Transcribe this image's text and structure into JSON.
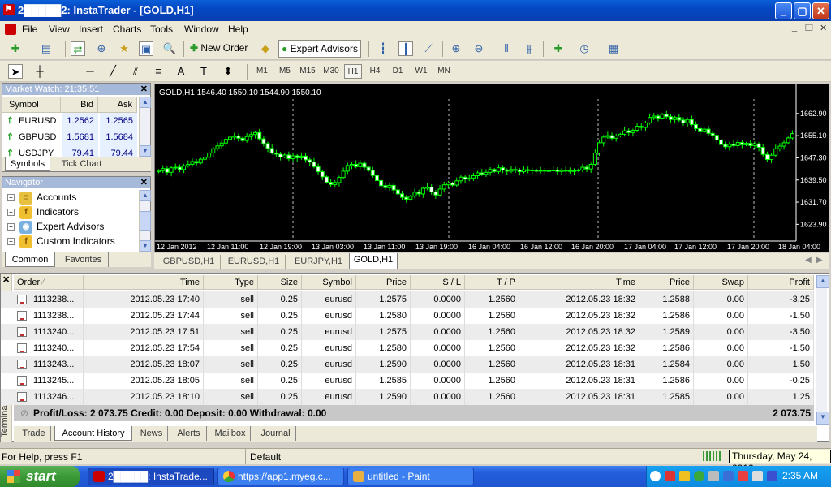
{
  "window": {
    "title": "2█████2: InstaTrader - [GOLD,H1]"
  },
  "menu": [
    "File",
    "View",
    "Insert",
    "Charts",
    "Tools",
    "Window",
    "Help"
  ],
  "toolbar": {
    "new_order": "New Order",
    "expert_advisors": "Expert Advisors"
  },
  "timeframes": [
    "M1",
    "M5",
    "M15",
    "M30",
    "H1",
    "H4",
    "D1",
    "W1",
    "MN"
  ],
  "active_timeframe": "H1",
  "market_watch": {
    "title": "Market Watch: 21:35:51",
    "columns": [
      "Symbol",
      "Bid",
      "Ask"
    ],
    "rows": [
      {
        "symbol": "EURUSD",
        "bid": "1.2562",
        "ask": "1.2565"
      },
      {
        "symbol": "GBPUSD",
        "bid": "1.5681",
        "ask": "1.5684"
      },
      {
        "symbol": "USDJPY",
        "bid": "79.41",
        "ask": "79.44"
      }
    ],
    "tabs": [
      "Symbols",
      "Tick Chart"
    ]
  },
  "navigator": {
    "title": "Navigator",
    "items": [
      "Accounts",
      "Indicators",
      "Expert Advisors",
      "Custom Indicators"
    ],
    "tabs": [
      "Common",
      "Favorites"
    ]
  },
  "chart": {
    "header": "GOLD,H1  1546.40 1550.10 1544.90 1550.10",
    "price_labels": [
      "1662.90",
      "1655.10",
      "1647.30",
      "1639.50",
      "1631.70",
      "1623.90"
    ],
    "time_labels": [
      "12 Jan 2012",
      "12 Jan 11:00",
      "12 Jan 19:00",
      "13 Jan 03:00",
      "13 Jan 11:00",
      "13 Jan 19:00",
      "16 Jan 04:00",
      "16 Jan 12:00",
      "16 Jan 20:00",
      "17 Jan 04:00",
      "17 Jan 12:00",
      "17 Jan 20:00",
      "18 Jan 04:00"
    ],
    "tabs": [
      "GBPUSD,H1",
      "EURUSD,H1",
      "EURJPY,H1",
      "GOLD,H1"
    ],
    "active_tab": "GOLD,H1",
    "colors": {
      "background": "#000000",
      "candle": "#00ff00",
      "text": "#ffffff"
    }
  },
  "chart_data": {
    "type": "candlestick",
    "symbol": "GOLD",
    "timeframe": "H1",
    "ylim": [
      1620.0,
      1668.0
    ],
    "y_ticks": [
      1662.9,
      1655.1,
      1647.3,
      1639.5,
      1631.7,
      1623.9
    ],
    "closes": [
      1642.8,
      1643.5,
      1642.2,
      1643.8,
      1644.0,
      1643.2,
      1644.5,
      1645.0,
      1646.0,
      1645.5,
      1646.8,
      1647.5,
      1649.0,
      1650.5,
      1651.5,
      1652.5,
      1653.8,
      1654.6,
      1655.0,
      1654.2,
      1653.4,
      1654.8,
      1655.5,
      1656.2,
      1654.0,
      1652.3,
      1650.6,
      1649.0,
      1648.6,
      1647.6,
      1648.3,
      1647.0,
      1648.0,
      1647.3,
      1647.9,
      1646.6,
      1645.8,
      1644.2,
      1642.4,
      1640.6,
      1638.7,
      1637.9,
      1638.6,
      1640.4,
      1642.6,
      1644.6,
      1645.0,
      1644.2,
      1645.4,
      1644.0,
      1642.9,
      1641.1,
      1639.3,
      1637.5,
      1636.8,
      1637.6,
      1636.0,
      1634.6,
      1633.4,
      1632.7,
      1633.8,
      1635.2,
      1634.6,
      1636.6,
      1637.0,
      1635.3,
      1634.2,
      1636.3,
      1637.8,
      1638.4,
      1637.7,
      1639.2,
      1640.5,
      1639.8,
      1640.2,
      1641.0,
      1642.0,
      1641.5,
      1642.2,
      1643.2,
      1642.5,
      1643.8,
      1643.0,
      1642.6,
      1643.2,
      1643.0,
      1642.4,
      1643.1,
      1642.8,
      1643.0,
      1642.6,
      1642.9,
      1642.7,
      1642.8,
      1643.0,
      1642.5,
      1642.9,
      1642.8,
      1642.6,
      1642.8,
      1643.0,
      1644.0,
      1643.4,
      1645.0,
      1649.0,
      1652.6,
      1654.6,
      1655.1,
      1654.2,
      1655.0,
      1655.6,
      1656.8,
      1656.2,
      1657.0,
      1658.4,
      1658.0,
      1659.6,
      1661.5,
      1662.0,
      1661.3,
      1662.6,
      1661.8,
      1660.8,
      1661.5,
      1660.6,
      1659.6,
      1660.8,
      1659.0,
      1657.6,
      1656.5,
      1657.4,
      1655.9,
      1655.2,
      1653.6,
      1652.0,
      1651.2,
      1652.1,
      1651.6,
      1652.7,
      1651.9,
      1652.4,
      1651.6,
      1652.2,
      1651.0,
      1648.5,
      1646.7,
      1648.2,
      1650.5,
      1651.4,
      1652.6,
      1654.3,
      1655.8
    ]
  },
  "terminal": {
    "columns": [
      "Order",
      "Time",
      "Type",
      "Size",
      "Symbol",
      "Price",
      "S / L",
      "T / P",
      "Time",
      "Price",
      "Swap",
      "Profit"
    ],
    "rows": [
      [
        "1113238...",
        "2012.05.23 17:40",
        "sell",
        "0.25",
        "eurusd",
        "1.2575",
        "0.0000",
        "1.2560",
        "2012.05.23 18:32",
        "1.2588",
        "0.00",
        "-3.25"
      ],
      [
        "1113238...",
        "2012.05.23 17:44",
        "sell",
        "0.25",
        "eurusd",
        "1.2580",
        "0.0000",
        "1.2560",
        "2012.05.23 18:32",
        "1.2586",
        "0.00",
        "-1.50"
      ],
      [
        "1113240...",
        "2012.05.23 17:51",
        "sell",
        "0.25",
        "eurusd",
        "1.2575",
        "0.0000",
        "1.2560",
        "2012.05.23 18:32",
        "1.2589",
        "0.00",
        "-3.50"
      ],
      [
        "1113240...",
        "2012.05.23 17:54",
        "sell",
        "0.25",
        "eurusd",
        "1.2580",
        "0.0000",
        "1.2560",
        "2012.05.23 18:32",
        "1.2586",
        "0.00",
        "-1.50"
      ],
      [
        "1113243...",
        "2012.05.23 18:07",
        "sell",
        "0.25",
        "eurusd",
        "1.2590",
        "0.0000",
        "1.2560",
        "2012.05.23 18:31",
        "1.2584",
        "0.00",
        "1.50"
      ],
      [
        "1113245...",
        "2012.05.23 18:05",
        "sell",
        "0.25",
        "eurusd",
        "1.2585",
        "0.0000",
        "1.2560",
        "2012.05.23 18:31",
        "1.2586",
        "0.00",
        "-0.25"
      ],
      [
        "1113246...",
        "2012.05.23 18:10",
        "sell",
        "0.25",
        "eurusd",
        "1.2590",
        "0.0000",
        "1.2560",
        "2012.05.23 18:31",
        "1.2585",
        "0.00",
        "1.25"
      ]
    ],
    "summary": "Profit/Loss: 2 073.75  Credit: 0.00  Deposit: 0.00  Withdrawal: 0.00",
    "summary_total": "2 073.75",
    "tabs": [
      "Trade",
      "Account History",
      "News",
      "Alerts",
      "Mailbox",
      "Journal"
    ],
    "active_tab": "Account History",
    "side_label": "Terminal"
  },
  "status": {
    "help": "For Help, press F1",
    "profile": "Default",
    "date_tooltip": "Thursday, May 24, 2012"
  },
  "taskbar": {
    "start": "start",
    "tasks": [
      "2█████: InstaTrade...",
      "https://app1.myeg.c...",
      "untitled - Paint"
    ],
    "clock": "2:35 AM"
  }
}
